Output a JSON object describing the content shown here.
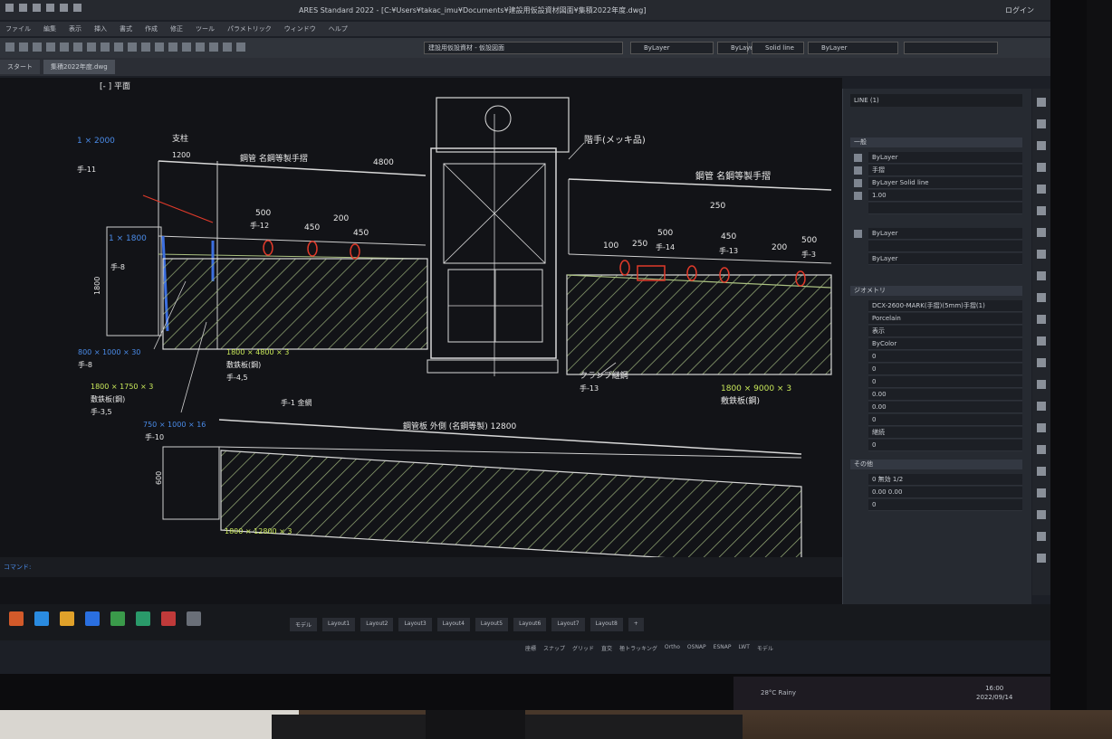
{
  "window": {
    "title": "ARES Standard 2022 - [C:¥Users¥takac_imu¥Documents¥建設用仮設資材図面¥集積2022年度.dwg]",
    "user_label": "ログイン"
  },
  "menubar": [
    "ファイル",
    "編集",
    "表示",
    "挿入",
    "書式",
    "作成",
    "修正",
    "ツール",
    "パラメトリック",
    "ウィンドウ",
    "ヘルプ"
  ],
  "toolbar": {
    "layer_combo": "建設用仮設資材 - 仮設図面",
    "color_combo": "ByLayer",
    "linetype_combo": "ByLayer",
    "lineweight_combo": "Solid line",
    "plot_combo": "ByLayer"
  },
  "tabs": [
    "スタート",
    "集積2022年度.dwg"
  ],
  "drawing": {
    "view_label": "[- ] 平面",
    "labels": {
      "top_dim": "1 × 2000",
      "top_rail": "手-11",
      "pillar": "支柱",
      "pillar_dim": "1200",
      "upper_left_note": "鋼管 名鋼等製手摺",
      "upper_left_len": "4800",
      "handrail": "階手(メッキ品)",
      "upper_right_note": "鋼管 名鋼等製手摺",
      "left_block_dim": "1 × 1800",
      "left_block_tag": "手-8",
      "left_vert_dim": "1800",
      "d500a": "500",
      "d450a": "450",
      "d200a": "200",
      "d450b": "450",
      "tag12": "手-12",
      "d100": "100",
      "d250a": "250",
      "d500b": "500",
      "tag14": "手-14",
      "d250b": "250",
      "d450c": "450",
      "tag13": "手-13",
      "d200b": "200",
      "d500c": "500",
      "tag3": "手-3",
      "blue_a": "800 × 1000 × 30",
      "blue_a_tag": "手-8",
      "green_a": "1800 × 1750 × 3",
      "green_a_tag": "敷鉄板(鋼)",
      "green_a_tag2": "手-3,5",
      "blue_b": "750 × 1000 × 16",
      "blue_b_tag": "手-10",
      "green_b": "1800 × 4800 × 3",
      "green_b_tag": "敷鉄板(鋼)",
      "green_b_tag2": "手-4,5",
      "handrail2": "手-1 金網",
      "clamp": "クランプ継鋼",
      "clamp_tag": "手-13",
      "green_c": "1800 × 9000 × 3",
      "green_c_tag": "敷鉄板(鋼)",
      "bottom_note": "鋼管板 外側 (名鋼等製) 12800",
      "bottom_dim": "1800 × 12800 × 3",
      "bottom_left_dim": "600"
    }
  },
  "command_line": "コマンド:",
  "properties": {
    "header": "LINE (1)",
    "section_general": "一般",
    "rows_general": [
      "ByLayer",
      "手摺",
      "ByLayer  Solid line",
      "1.00",
      "",
      "ByLayer",
      "",
      "ByLayer"
    ],
    "section_geometry": "ジオメトリ",
    "rows_geometry": [
      "DCX-2600-MARK(手摺)(5mm)手摺(1)",
      "Porcelain",
      "表示",
      "ByColor",
      "0",
      "0",
      "0",
      "0.00",
      "0.00",
      "0",
      "継続",
      "0"
    ],
    "section_misc": "その他",
    "rows_misc": [
      "0 無効 1/2",
      "0.00 0.00",
      "0"
    ]
  },
  "layout_tabs": [
    "モデル",
    "Layout1",
    "Layout2",
    "Layout3",
    "Layout4",
    "Layout5",
    "Layout6",
    "Layout7",
    "Layout8",
    "+"
  ],
  "status": [
    "座標",
    "スナップ",
    "グリッド",
    "直交",
    "極トラッキング",
    "Ortho",
    "OSNAP",
    "ESNAP",
    "LWT",
    "モデル"
  ],
  "win_taskbar": {
    "weather": "28°C  Rainy",
    "time": "16:00",
    "date": "2022/09/14"
  },
  "colors": {
    "accent_blue": "#4a8be8",
    "dim_green": "#c9e85a",
    "hatch": "#8fc06a",
    "red_marker": "#e03a2a"
  }
}
